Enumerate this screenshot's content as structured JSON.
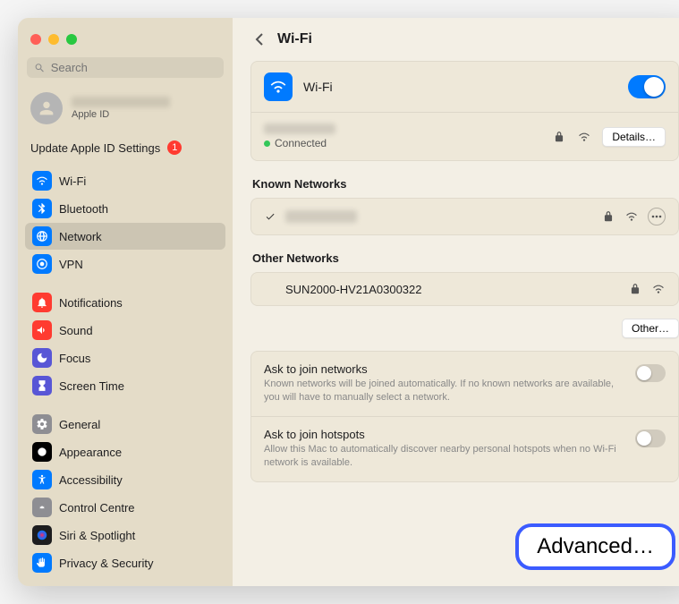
{
  "window": {
    "title": "Wi-Fi"
  },
  "traffic": {
    "close": "close",
    "min": "minimize",
    "max": "maximize"
  },
  "search": {
    "placeholder": "Search"
  },
  "appleid": {
    "name": "——",
    "sub": "Apple ID"
  },
  "update_row": {
    "label": "Update Apple ID Settings",
    "badge": "1"
  },
  "sidebar": {
    "groups": [
      [
        {
          "label": "Wi-Fi",
          "icon": "wifi",
          "bg": "#007aff"
        },
        {
          "label": "Bluetooth",
          "icon": "bluetooth",
          "bg": "#007aff"
        },
        {
          "label": "Network",
          "icon": "globe",
          "bg": "#007aff",
          "selected": true
        },
        {
          "label": "VPN",
          "icon": "vpn",
          "bg": "#007aff"
        }
      ],
      [
        {
          "label": "Notifications",
          "icon": "bell",
          "bg": "#ff3b30"
        },
        {
          "label": "Sound",
          "icon": "speaker",
          "bg": "#ff3b30"
        },
        {
          "label": "Focus",
          "icon": "moon",
          "bg": "#5856d6"
        },
        {
          "label": "Screen Time",
          "icon": "hourglass",
          "bg": "#5856d6"
        }
      ],
      [
        {
          "label": "General",
          "icon": "gear",
          "bg": "#8e8e93"
        },
        {
          "label": "Appearance",
          "icon": "appearance",
          "bg": "#000000"
        },
        {
          "label": "Accessibility",
          "icon": "accessibility",
          "bg": "#007aff"
        },
        {
          "label": "Control Centre",
          "icon": "control",
          "bg": "#8e8e93"
        },
        {
          "label": "Siri & Spotlight",
          "icon": "siri",
          "bg": "#1d1d1f"
        },
        {
          "label": "Privacy & Security",
          "icon": "hand",
          "bg": "#007aff"
        }
      ]
    ]
  },
  "main": {
    "header": {
      "title": "Wi-Fi"
    },
    "wifi_card": {
      "label": "Wi-Fi",
      "enabled": true
    },
    "connection": {
      "ssid": "——",
      "status": "Connected",
      "details_btn": "Details…"
    },
    "known": {
      "title": "Known Networks",
      "items": [
        {
          "ssid": "——",
          "connected": true,
          "secure": true
        }
      ]
    },
    "other": {
      "title": "Other Networks",
      "items": [
        {
          "ssid": "SUN2000-HV21A0300322",
          "secure": true
        }
      ],
      "other_btn": "Other…"
    },
    "settings": [
      {
        "title": "Ask to join networks",
        "desc": "Known networks will be joined automatically. If no known networks are available, you will have to manually select a network.",
        "on": false
      },
      {
        "title": "Ask to join hotspots",
        "desc": "Allow this Mac to automatically discover nearby personal hotspots when no Wi-Fi network is available.",
        "on": false
      }
    ],
    "advanced_btn": "Advanced…"
  }
}
